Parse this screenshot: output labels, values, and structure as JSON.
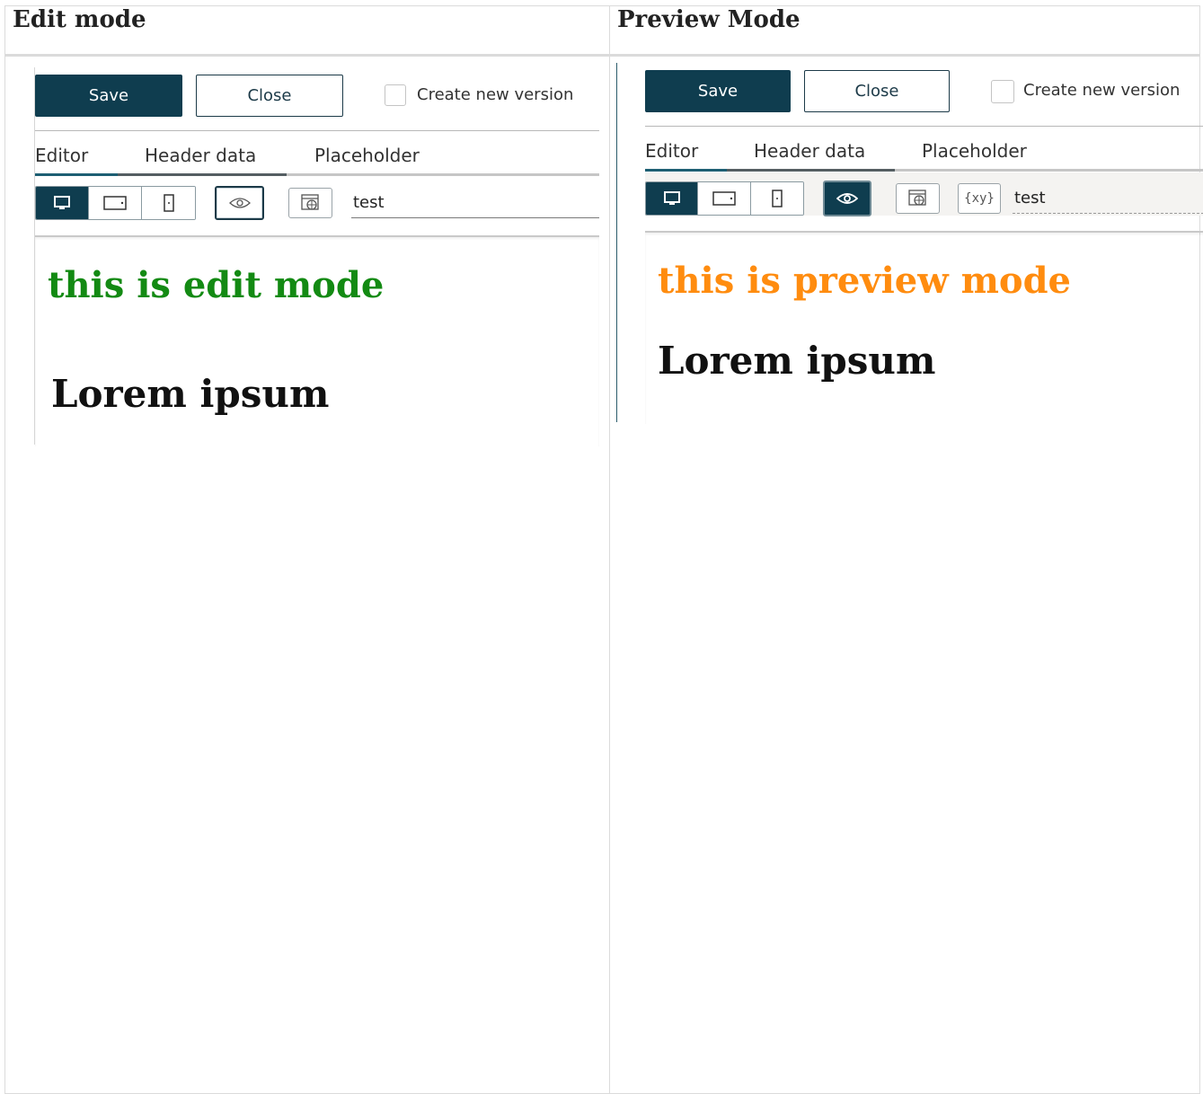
{
  "columns": [
    {
      "title": "Edit mode",
      "toolbar": {
        "save_label": "Save",
        "close_label": "Close",
        "create_version_label": "Create new version",
        "create_version_checked": false
      },
      "tabs": [
        "Editor",
        "Header data",
        "Placeholder"
      ],
      "active_tab": "Editor",
      "view_buttons": [
        "desktop-icon",
        "tablet-icon",
        "mobile-icon"
      ],
      "active_view": "desktop-icon",
      "preview_toggle_active": false,
      "tools": [
        "eye-icon",
        "web-settings-icon"
      ],
      "input_value": "test",
      "content": {
        "heading": "this is edit mode",
        "heading_color": "#138a13",
        "subheading": "Lorem ipsum"
      }
    },
    {
      "title": "Preview Mode",
      "toolbar": {
        "save_label": "Save",
        "close_label": "Close",
        "create_version_label": "Create new version",
        "create_version_checked": false
      },
      "tabs": [
        "Editor",
        "Header data",
        "Placeholder"
      ],
      "active_tab": "Editor",
      "view_buttons": [
        "desktop-icon",
        "tablet-icon",
        "mobile-icon"
      ],
      "active_view": "desktop-icon",
      "preview_toggle_active": true,
      "tools": [
        "eye-icon",
        "web-settings-icon",
        "variable-icon"
      ],
      "variable_button_label": "{xy}",
      "input_value": "test",
      "content": {
        "heading": "this is preview mode",
        "heading_color": "#ff8c0f",
        "subheading": "Lorem ipsum"
      }
    }
  ],
  "colors": {
    "primary": "#0f3d4f",
    "tab_active": "#1d5f73",
    "border": "#dbdbdb"
  }
}
